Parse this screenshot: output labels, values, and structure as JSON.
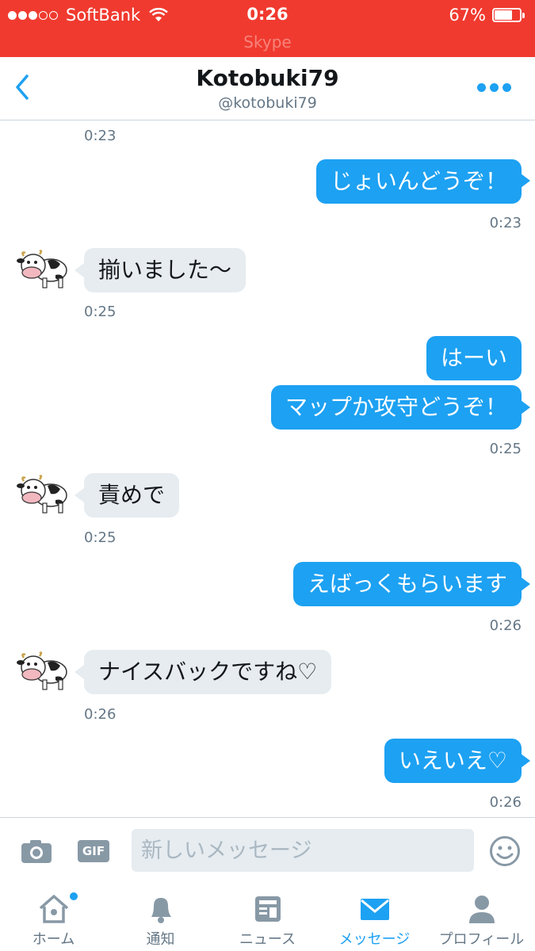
{
  "status_bar": {
    "carrier": "SoftBank",
    "time": "0:26",
    "battery": "67%",
    "app_back_label": "Skype"
  },
  "header": {
    "title": "Kotobuki79",
    "handle": "@kotobuki79"
  },
  "conversation": {
    "top_timestamp": "0:23",
    "messages": [
      {
        "direction": "out",
        "text": "じょいんどうぞ！",
        "time": "0:23"
      },
      {
        "direction": "in",
        "text": "揃いました〜",
        "time": "0:25"
      },
      {
        "direction": "out",
        "text": "はーい",
        "time": ""
      },
      {
        "direction": "out",
        "text": "マップか攻守どうぞ！",
        "time": "0:25"
      },
      {
        "direction": "in",
        "text": "責めで",
        "time": "0:25"
      },
      {
        "direction": "out",
        "text": "えばっくもらいます",
        "time": "0:26"
      },
      {
        "direction": "in",
        "text": "ナイスバックですね♡",
        "time": "0:26"
      },
      {
        "direction": "out",
        "text": "いえいえ♡",
        "time": "0:26"
      }
    ]
  },
  "composer": {
    "gif_label": "GIF",
    "placeholder": "新しいメッセージ"
  },
  "tabs": [
    {
      "label": "ホーム",
      "icon": "home-icon",
      "active": false
    },
    {
      "label": "通知",
      "icon": "bell-icon",
      "active": false
    },
    {
      "label": "ニュース",
      "icon": "news-icon",
      "active": false
    },
    {
      "label": "メッセージ",
      "icon": "envelope-icon",
      "active": true
    },
    {
      "label": "プロフィール",
      "icon": "person-icon",
      "active": false
    }
  ],
  "colors": {
    "status_bar": "#f03a2f",
    "accent": "#1da1f2",
    "incoming_bubble": "#e6ecf0",
    "muted_text": "#657786"
  }
}
